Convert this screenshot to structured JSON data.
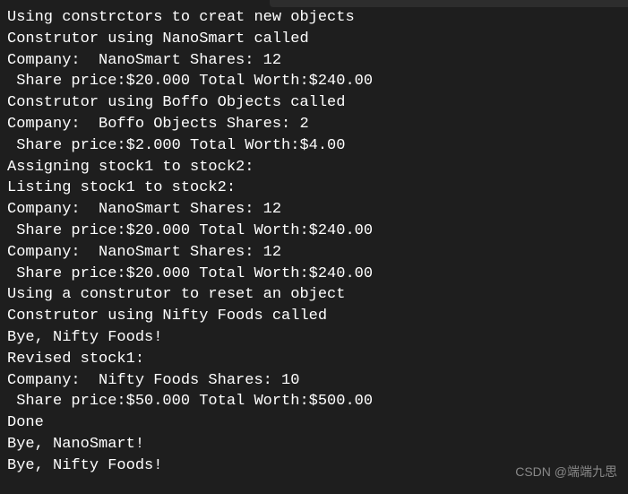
{
  "console": {
    "lines": [
      "Using constrctors to creat new objects",
      "Construtor using NanoSmart called",
      "Company:  NanoSmart Shares: 12",
      " Share price:$20.000 Total Worth:$240.00",
      "Construtor using Boffo Objects called",
      "Company:  Boffo Objects Shares: 2",
      " Share price:$2.000 Total Worth:$4.00",
      "Assigning stock1 to stock2:",
      "Listing stock1 to stock2:",
      "Company:  NanoSmart Shares: 12",
      " Share price:$20.000 Total Worth:$240.00",
      "Company:  NanoSmart Shares: 12",
      " Share price:$20.000 Total Worth:$240.00",
      "Using a construtor to reset an object",
      "Construtor using Nifty Foods called",
      "Bye, Nifty Foods!",
      "Revised stock1:",
      "Company:  Nifty Foods Shares: 10",
      " Share price:$50.000 Total Worth:$500.00",
      "Done",
      "Bye, NanoSmart!",
      "Bye, Nifty Foods!"
    ]
  },
  "watermark": "CSDN @端端九思"
}
